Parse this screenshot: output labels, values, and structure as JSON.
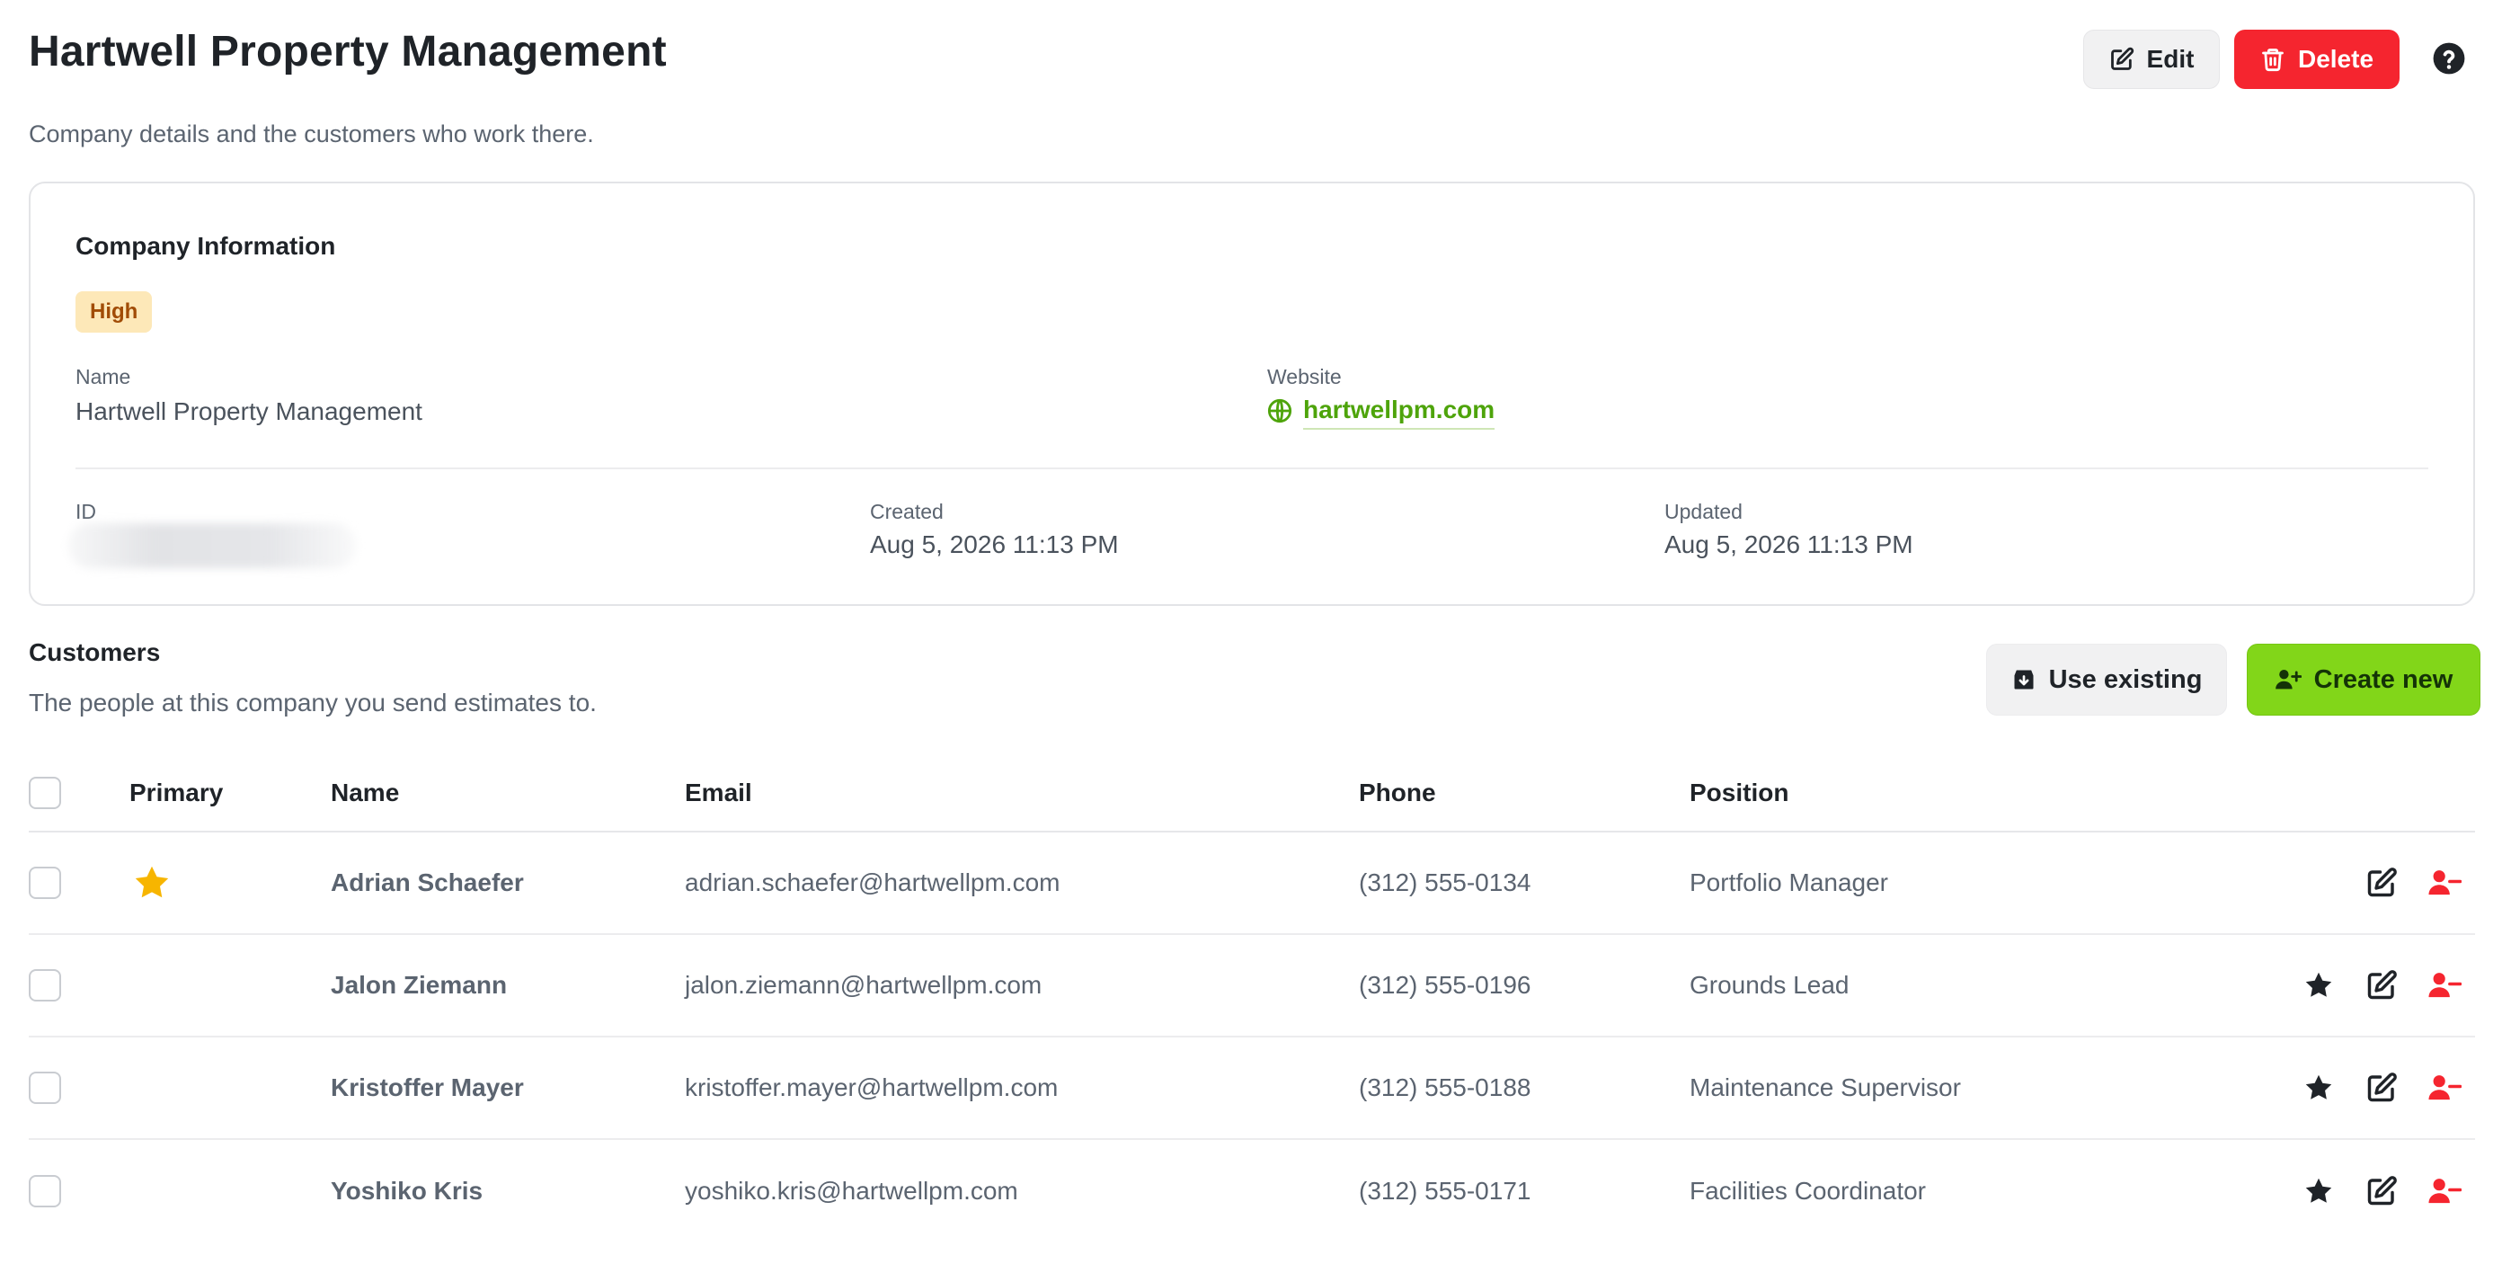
{
  "header": {
    "title": "Hartwell Property Management",
    "subtitle": "Company details and the customers who work there.",
    "edit_label": "Edit",
    "delete_label": "Delete"
  },
  "company": {
    "section_title": "Company Information",
    "priority_badge": "High",
    "name_label": "Name",
    "name_value": "Hartwell Property Management",
    "website_label": "Website",
    "website_value": "hartwellpm.com",
    "id_label": "ID",
    "created_label": "Created",
    "created_value": "Aug 5, 2026 11:13 PM",
    "updated_label": "Updated",
    "updated_value": "Aug 5, 2026 11:13 PM"
  },
  "customers": {
    "title": "Customers",
    "subtitle": "The people at this company you send estimates to.",
    "use_existing_label": "Use existing",
    "create_new_label": "Create new",
    "columns": {
      "primary": "Primary",
      "name": "Name",
      "email": "Email",
      "phone": "Phone",
      "position": "Position"
    },
    "rows": [
      {
        "primary": true,
        "name": "Adrian Schaefer",
        "email": "adrian.schaefer@hartwellpm.com",
        "phone": "(312) 555-0134",
        "position": "Portfolio Manager"
      },
      {
        "primary": false,
        "name": "Jalon Ziemann",
        "email": "jalon.ziemann@hartwellpm.com",
        "phone": "(312) 555-0196",
        "position": "Grounds Lead"
      },
      {
        "primary": false,
        "name": "Kristoffer Mayer",
        "email": "kristoffer.mayer@hartwellpm.com",
        "phone": "(312) 555-0188",
        "position": "Maintenance Supervisor"
      },
      {
        "primary": false,
        "name": "Yoshiko Kris",
        "email": "yoshiko.kris@hartwellpm.com",
        "phone": "(312) 555-0171",
        "position": "Facilities Coordinator"
      }
    ]
  },
  "colors": {
    "danger": "#f5252f",
    "accent_green": "#82d619",
    "link_green": "#4ea40b",
    "badge_bg": "#fde8b8",
    "badge_text": "#a14c06",
    "primary_star": "#f7b500"
  },
  "icons": {
    "edit": "pencil-square-icon",
    "delete": "trash-icon",
    "help": "question-circle-icon",
    "website": "globe-icon",
    "use_existing": "download-box-icon",
    "create_new": "user-plus-icon",
    "primary": "star-icon",
    "remove": "user-minus-icon"
  }
}
